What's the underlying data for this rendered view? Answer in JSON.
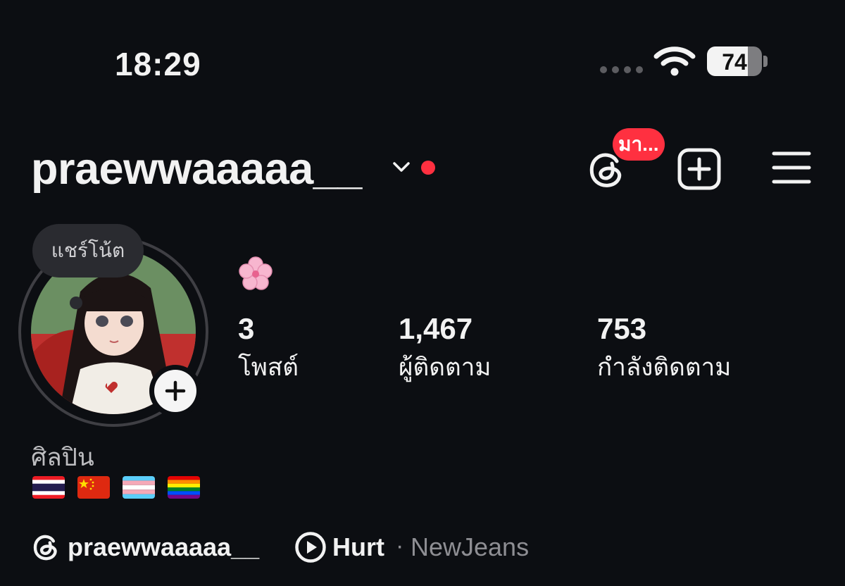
{
  "status_bar": {
    "time": "18:29",
    "battery_percent": 74
  },
  "header": {
    "username": "praewwaaaaa__",
    "threads_badge": "มา..."
  },
  "profile": {
    "note_placeholder": "แชร์โน้ต",
    "bio_emoji_icon": "cherry-blossom-icon",
    "category": "ศิลปิน",
    "flags": [
      "thailand-flag-icon",
      "china-flag-icon",
      "transgender-flag-icon",
      "rainbow-flag-icon"
    ]
  },
  "stats": [
    {
      "value": "3",
      "label": "โพสต์"
    },
    {
      "value": "1,467",
      "label": "ผู้ติดตาม"
    },
    {
      "value": "753",
      "label": "กำลังติดตาม"
    }
  ],
  "links": {
    "threads_handle": "praewwaaaaa__",
    "song_title": "Hurt",
    "song_separator": "·",
    "song_artist": "NewJeans"
  },
  "colors": {
    "background": "#0c0e12",
    "badge": "#ff3040",
    "text": "#f2f2f2"
  }
}
